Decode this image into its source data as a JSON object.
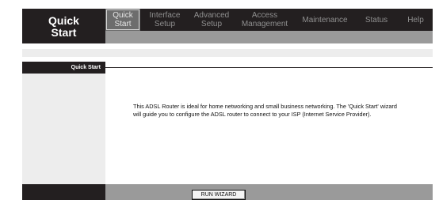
{
  "brand": {
    "title_line1": "Quick",
    "title_line2": "Start"
  },
  "nav": [
    {
      "line1": "Quick",
      "line2": "Start",
      "active": true
    },
    {
      "line1": "Interface",
      "line2": "Setup",
      "active": false
    },
    {
      "line1": "Advanced",
      "line2": "Setup",
      "active": false
    },
    {
      "line1": "Access",
      "line2": "Management",
      "active": false
    },
    {
      "line1": "Maintenance",
      "line2": "",
      "active": false
    },
    {
      "line1": "Status",
      "line2": "",
      "active": false
    },
    {
      "line1": "Help",
      "line2": "",
      "active": false
    }
  ],
  "section": {
    "title": "Quick Start"
  },
  "content": {
    "description": "This ADSL Router is ideal for home networking and small business networking. The 'Quick Start' wizard will guide you to configure the ADSL router to connect to your ISP (Internet Service Provider)."
  },
  "footer": {
    "wizard_button": "RUN WIZARD"
  },
  "colors": {
    "dark": "#231f20",
    "gray_bar": "#9a9a9a",
    "light_panel": "#ededed",
    "active_tab": "#6d6d6d"
  }
}
